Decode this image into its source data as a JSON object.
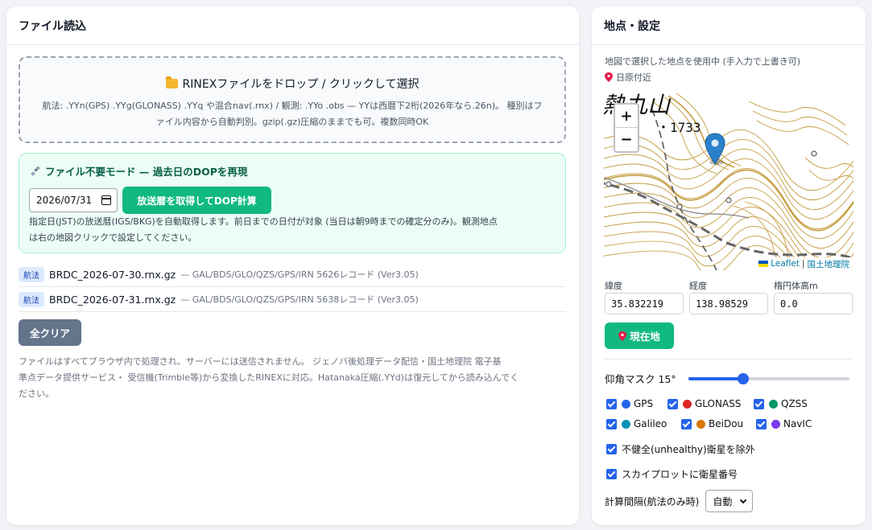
{
  "left": {
    "title": "ファイル読込",
    "dropzone": {
      "title": "RINEXファイルをドロップ / クリックして選択",
      "desc_line1": "航法: .YYn(GPS) .YYg(GLONASS) .YYq や混合nav(.rnx) / 観測: .YYo .obs — YYは西暦下2桁(2026年なら.26n)。 種別はフ",
      "desc_line2": "ァイル内容から自動判別。gzip(.gz)圧縮のままでも可。複数同時OK"
    },
    "nofile": {
      "title": "ファイル不要モード — 過去日のDOPを再現",
      "date_value": "2026/07/31",
      "fetch_button": "放送暦を取得してDOP計算",
      "desc_line1": "指定日(JST)の放送暦(IGS/BKG)を自動取得します。前日までの日付が対象 (当日は朝9時までの確定分のみ)。観測地点",
      "desc_line2": "は右の地図クリックで設定してください。"
    },
    "files": [
      {
        "badge": "航法",
        "name": "BRDC_2026-07-30.rnx.gz",
        "meta": "— GAL/BDS/GLO/QZS/GPS/IRN 5626レコード (Ver3.05)"
      },
      {
        "badge": "航法",
        "name": "BRDC_2026-07-31.rnx.gz",
        "meta": "— GAL/BDS/GLO/QZS/GPS/IRN 5638レコード (Ver3.05)"
      }
    ],
    "clear_button": "全クリア",
    "footnote_line1": "ファイルはすべてブラウザ内で処理され、サーバーには送信されません。 ジェノバ後処理データ配信・国土地理院 電子基",
    "footnote_line2": "準点データ提供サービス・ 受信機(Trimble等)から変換したRINEXに対応。Hatanaka圧縮(.YYd)は復元してから読み込んでく",
    "footnote_line3": "ださい。"
  },
  "right": {
    "title": "地点・設定",
    "subtitle": "地図で選択した地点を使用中 (手入力で上書き可)",
    "location_name": "日原付近",
    "map": {
      "label_mountain": "熱丸山",
      "label_elevation": "・1733",
      "zoom_in": "+",
      "zoom_out": "−",
      "attribution_leaflet": "Leaflet",
      "attribution_sep": "|",
      "attribution_gsi": "国土地理院"
    },
    "fields": {
      "lat_label": "緯度",
      "lat_value": "35.832219",
      "lon_label": "経度",
      "lon_value": "138.98529",
      "h_label": "楕円体高m",
      "h_value": "0.0"
    },
    "current_location_button": "現在地",
    "elevation_mask": {
      "label": "仰角マスク 15°",
      "value_deg": 15,
      "fill_fraction": 0.34
    },
    "constellations": [
      {
        "label": "GPS",
        "color": "#2563eb",
        "checked": true
      },
      {
        "label": "GLONASS",
        "color": "#dc2626",
        "checked": true
      },
      {
        "label": "QZSS",
        "color": "#059669",
        "checked": true
      },
      {
        "label": "Galileo",
        "color": "#0891b2",
        "checked": true
      },
      {
        "label": "BeiDou",
        "color": "#d97706",
        "checked": true
      },
      {
        "label": "NavIC",
        "color": "#7c3aed",
        "checked": true
      }
    ],
    "exclude_unhealthy": "不健全(unhealthy)衛星を除外",
    "skyplot_numbers": "スカイプロットに衛星番号",
    "interval_label": "計算間隔(航法のみ時)",
    "interval_value": "自動"
  }
}
